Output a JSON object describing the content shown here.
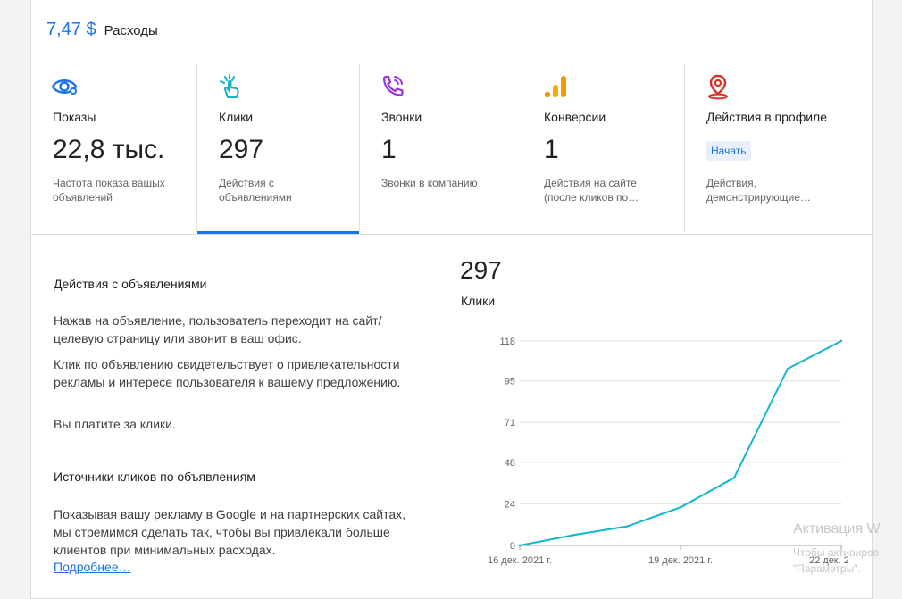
{
  "header": {
    "cost": "7,47 $",
    "cost_label": "Расходы"
  },
  "metrics": [
    {
      "title": "Показы",
      "value": "22,8 тыс.",
      "desc": "Частота показа вашых объявлений",
      "icon": "eye-icon",
      "color": "#1a73e8"
    },
    {
      "title": "Клики",
      "value": "297",
      "desc": "Действия с объявлениями",
      "icon": "tap-icon",
      "color": "#12b5cb"
    },
    {
      "title": "Звонки",
      "value": "1",
      "desc": "Звонки в компанию",
      "icon": "phone-call-icon",
      "color": "#9334e6"
    },
    {
      "title": "Конверсии",
      "value": "1",
      "desc": "Действия на сайте (после кликов по…",
      "icon": "bars-icon",
      "color": "#f29900"
    },
    {
      "title": "Действия в профиле",
      "button": "Начать",
      "desc": "Действия, демонстрирующие…",
      "icon": "location-pin-icon",
      "color": "#d93025"
    }
  ],
  "info": {
    "section1_title": "Действия с объявлениями",
    "p1": "Нажав на объявление, пользователь переходит на сайт/целевую страницу или звонит в ваш офис.",
    "p2": "Клик по объявлению свидетельствует о привлекательности рекламы и интересе пользователя к вашему предложению.",
    "p3": "Вы платите за клики.",
    "section2_title": "Источники кликов по объявлениям",
    "p4": "Показывая вашу рекламу в Google и на партнерских сайтах, мы стремимся сделать так, чтобы вы привлекали больше клиентов при минимальных расходах.",
    "link": "Подробнее…"
  },
  "chart_summary": {
    "value": "297",
    "label": "Клики"
  },
  "chart_data": {
    "type": "line",
    "y_ticks": [
      0,
      24,
      48,
      71,
      95,
      118
    ],
    "ylim": [
      0,
      118
    ],
    "x_tick_labels": [
      "16 дек. 2021 г.",
      "19 дек. 2021 г.",
      "22 дек. 2021 г."
    ],
    "x_tick_positions": [
      0,
      3,
      6
    ],
    "x": [
      0,
      1,
      2,
      3,
      4,
      5,
      6
    ],
    "values": [
      0,
      6,
      11,
      22,
      39,
      102,
      118
    ],
    "series_color": "#12b5cb",
    "grid": true
  },
  "watermark": {
    "line1": "Активация W",
    "line2": "Чтобы активиров",
    "line3": "\"Параметры\"."
  }
}
